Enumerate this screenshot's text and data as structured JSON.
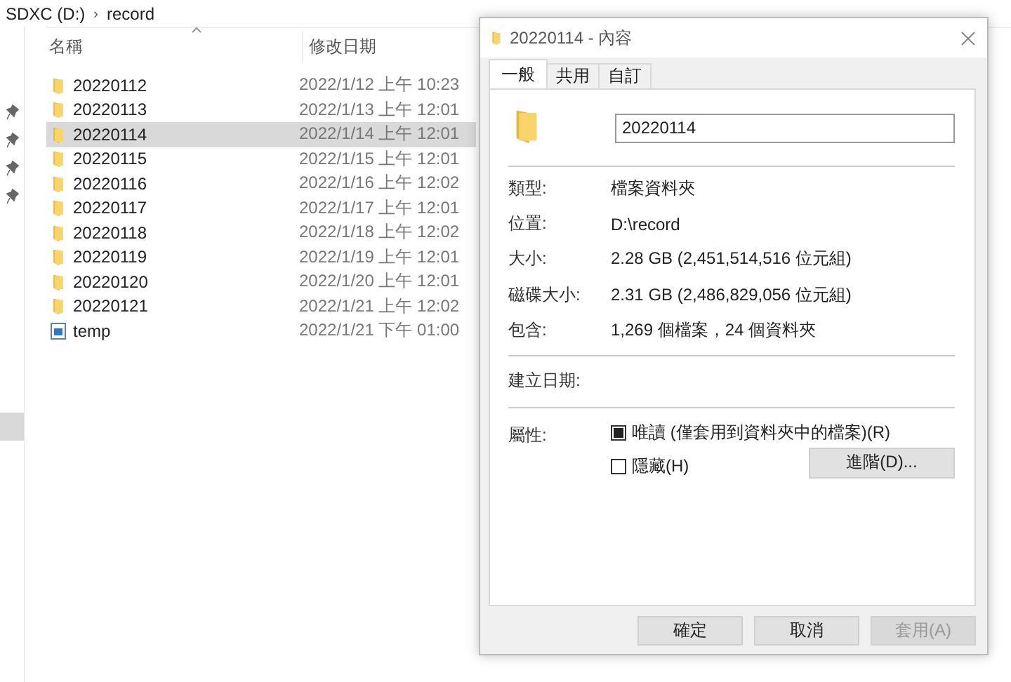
{
  "breadcrumb": {
    "drive": "SDXC (D:)",
    "separator": "›",
    "folder": "record"
  },
  "columns": [
    {
      "label": "名稱"
    },
    {
      "label": "修改日期"
    }
  ],
  "files": [
    {
      "kind": "folder",
      "name": "20220112",
      "modified": "2022/1/12 上午 10:23",
      "selected": false
    },
    {
      "kind": "folder",
      "name": "20220113",
      "modified": "2022/1/13 上午 12:01",
      "selected": false
    },
    {
      "kind": "folder",
      "name": "20220114",
      "modified": "2022/1/14 上午 12:01",
      "selected": true
    },
    {
      "kind": "folder",
      "name": "20220115",
      "modified": "2022/1/15 上午 12:01",
      "selected": false
    },
    {
      "kind": "folder",
      "name": "20220116",
      "modified": "2022/1/16 上午 12:02",
      "selected": false
    },
    {
      "kind": "folder",
      "name": "20220117",
      "modified": "2022/1/17 上午 12:01",
      "selected": false
    },
    {
      "kind": "folder",
      "name": "20220118",
      "modified": "2022/1/18 上午 12:02",
      "selected": false
    },
    {
      "kind": "folder",
      "name": "20220119",
      "modified": "2022/1/19 上午 12:01",
      "selected": false
    },
    {
      "kind": "folder",
      "name": "20220120",
      "modified": "2022/1/20 上午 12:01",
      "selected": false
    },
    {
      "kind": "folder",
      "name": "20220121",
      "modified": "2022/1/21 上午 12:02",
      "selected": false
    },
    {
      "kind": "file",
      "name": "temp",
      "modified": "2022/1/21 下午 01:00",
      "selected": false
    }
  ],
  "dialog": {
    "title": "20220114 - 內容",
    "tabs": [
      {
        "label": "一般",
        "selected": true
      },
      {
        "label": "共用",
        "selected": false
      },
      {
        "label": "自訂",
        "selected": false
      }
    ],
    "name_value": "20220114",
    "info": [
      {
        "label": "類型:",
        "value": "檔案資料夾"
      },
      {
        "label": "位置:",
        "value": "D:\\record"
      },
      {
        "label": "大小:",
        "value": "2.28 GB (2,451,514,516 位元組)"
      },
      {
        "label": "磁碟大小:",
        "value": "2.31 GB (2,486,829,056 位元組)"
      },
      {
        "label": "包含:",
        "value": "1,269 個檔案，24 個資料夾"
      }
    ],
    "created_label": "建立日期:",
    "attributes_label": "屬性:",
    "attributes": [
      {
        "label": "唯讀 (僅套用到資料夾中的檔案)(R)",
        "checked": false,
        "indeterminate": true
      },
      {
        "label": "隱藏(H)",
        "checked": false,
        "indeterminate": false
      }
    ],
    "advanced_button": "進階(D)...",
    "buttons": [
      {
        "label": "確定",
        "disabled": false
      },
      {
        "label": "取消",
        "disabled": false
      },
      {
        "label": "套用(A)",
        "disabled": true
      }
    ]
  }
}
